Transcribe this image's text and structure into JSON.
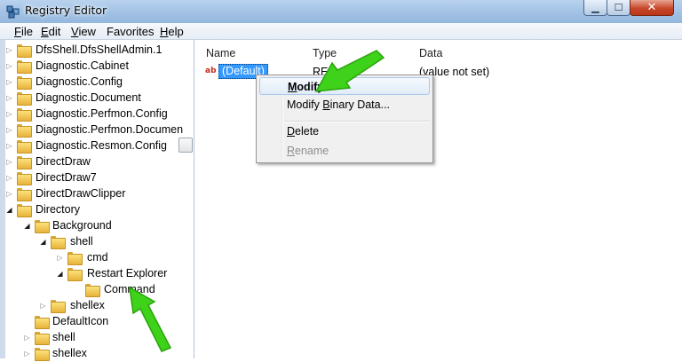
{
  "window": {
    "title": "Registry Editor",
    "close_glyph": "✕",
    "min_glyph": "▁",
    "max_glyph": "☐"
  },
  "menubar": [
    {
      "label": "File",
      "ul": "F",
      "rest": "ile"
    },
    {
      "label": "Edit",
      "ul": "E",
      "rest": "dit"
    },
    {
      "label": "View",
      "ul": "V",
      "rest": "iew"
    },
    {
      "label": "Favorites",
      "ul": "",
      "rest": "Favorites"
    },
    {
      "label": "Help",
      "ul": "H",
      "rest": "elp"
    }
  ],
  "tree": {
    "items": [
      {
        "label": "DfsShell.DfsShellAdmin.1",
        "state": "collapsed"
      },
      {
        "label": "Diagnostic.Cabinet",
        "state": "collapsed"
      },
      {
        "label": "Diagnostic.Config",
        "state": "collapsed"
      },
      {
        "label": "Diagnostic.Document",
        "state": "collapsed"
      },
      {
        "label": "Diagnostic.Perfmon.Config",
        "state": "collapsed"
      },
      {
        "label": "Diagnostic.Perfmon.Documen",
        "state": "collapsed"
      },
      {
        "label": "Diagnostic.Resmon.Config",
        "state": "collapsed"
      },
      {
        "label": "DirectDraw",
        "state": "collapsed"
      },
      {
        "label": "DirectDraw7",
        "state": "collapsed"
      },
      {
        "label": "DirectDrawClipper",
        "state": "collapsed"
      },
      {
        "label": "Directory",
        "state": "expanded"
      },
      {
        "label": "Background",
        "state": "expanded"
      },
      {
        "label": "shell",
        "state": "expanded"
      },
      {
        "label": "cmd",
        "state": "collapsed"
      },
      {
        "label": "Restart Explorer",
        "state": "expanded"
      },
      {
        "label": "Command",
        "state": "leaf"
      },
      {
        "label": "shellex",
        "state": "collapsed"
      },
      {
        "label": "DefaultIcon",
        "state": "leaf"
      },
      {
        "label": "shell",
        "state": "collapsed"
      },
      {
        "label": "shellex",
        "state": "collapsed"
      }
    ]
  },
  "values_pane": {
    "columns": {
      "name": "Name",
      "type": "Type",
      "data": "Data"
    },
    "row": {
      "name": "(Default)",
      "type_partial": "REG",
      "data": "(value not set)",
      "icon_text": "ab"
    }
  },
  "context_menu": {
    "items": [
      {
        "label": "Modify...",
        "ul": "M",
        "rest": "odify...",
        "pre": ""
      },
      {
        "label": "Modify Binary Data...",
        "pre": "Modify ",
        "ul": "B",
        "rest": "inary Data..."
      },
      {
        "label": "Delete",
        "ul": "D",
        "rest": "elete",
        "pre": ""
      },
      {
        "label": "Rename",
        "ul": "R",
        "rest": "ename",
        "pre": ""
      }
    ]
  },
  "colors": {
    "selection": "#3399ff",
    "arrow": "#3fd21a",
    "titlebar": "#a5c4e6"
  }
}
